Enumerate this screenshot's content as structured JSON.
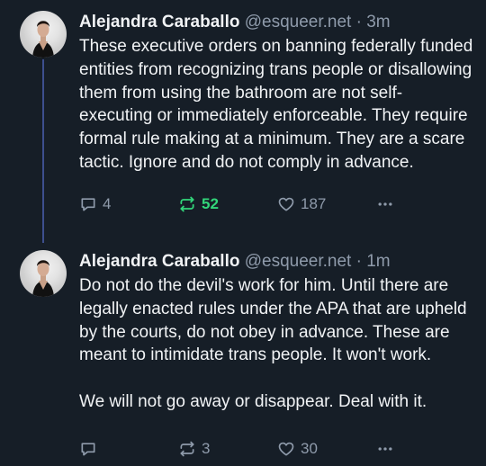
{
  "colors": {
    "background": "#161e27",
    "text": "#f1f3f5",
    "muted": "#8f9bab",
    "thread_line": "#3d4f8e",
    "repost_active": "#32d67a"
  },
  "posts": [
    {
      "author_name": "Alejandra Caraballo",
      "author_handle": "@esqueer.net",
      "separator": "·",
      "time": "3m",
      "paragraphs": [
        "These executive orders on banning federally funded entities from recognizing trans people or disallowing them from using the bathroom are not self-executing or immediately enforceable. They require formal rule making at a minimum. They are a scare tactic. Ignore and do not comply in advance."
      ],
      "reply_count": "4",
      "repost_count": "52",
      "repost_active": true,
      "like_count": "187",
      "icons": [
        "avatar",
        "reply-icon",
        "repost-icon",
        "like-icon",
        "more-icon"
      ]
    },
    {
      "author_name": "Alejandra Caraballo",
      "author_handle": "@esqueer.net",
      "separator": "·",
      "time": "1m",
      "paragraphs": [
        "Do not do the devil's work for him. Until there are legally enacted rules under the APA that are upheld by the courts, do not obey in advance. These are meant to intimidate trans people. It won't work.",
        "We will not go away or disappear. Deal with it."
      ],
      "reply_count": "",
      "repost_count": "3",
      "repost_active": false,
      "like_count": "30",
      "icons": [
        "avatar",
        "reply-icon",
        "repost-icon",
        "like-icon",
        "more-icon"
      ]
    }
  ]
}
